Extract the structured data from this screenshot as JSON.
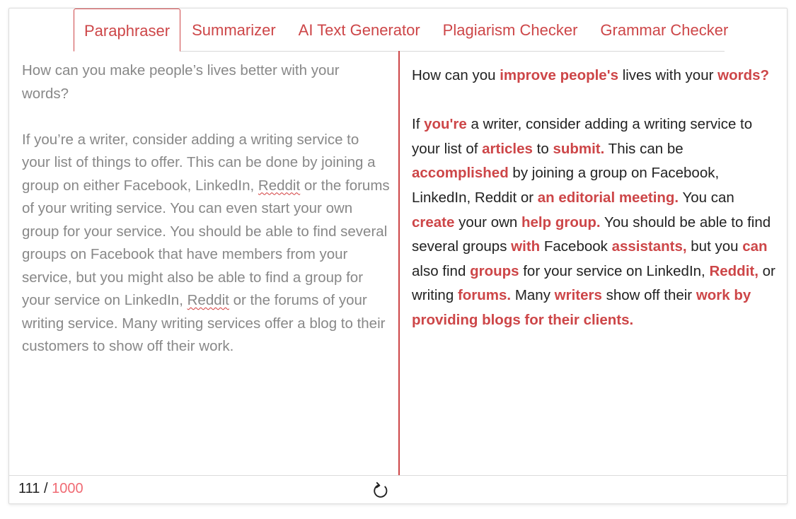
{
  "tabs": [
    {
      "label": "Paraphraser",
      "active": true
    },
    {
      "label": "Summarizer",
      "active": false
    },
    {
      "label": "AI Text Generator",
      "active": false
    },
    {
      "label": "Plagiarism Checker",
      "active": false
    },
    {
      "label": "Grammar Checker",
      "active": false
    }
  ],
  "input": {
    "p1": "How can you make people’s lives better with your words?",
    "p2_a": "If you’re a writer, consider adding a writing service to your list of things to offer. This can be done by joining a group on either Facebook, LinkedIn, ",
    "p2_flag1": "Reddit",
    "p2_b": " or the forums of your writing service. You can even start your own group for your service. You should be able to find several groups on Facebook that have members from your service, but you might also be able to find a group for your service on LinkedIn, ",
    "p2_flag2": "Reddit",
    "p2_c": " or the forums of your writing service. Many writing services offer a blog to their customers to show off their work."
  },
  "output": {
    "p1": [
      {
        "t": "How can you ",
        "h": false
      },
      {
        "t": "improve people's",
        "h": true
      },
      {
        "t": " lives with your ",
        "h": false
      },
      {
        "t": "words?",
        "h": true
      }
    ],
    "p2": [
      {
        "t": "If ",
        "h": false
      },
      {
        "t": "you're",
        "h": true
      },
      {
        "t": " a writer, consider adding a writing service to your list of ",
        "h": false
      },
      {
        "t": "articles",
        "h": true
      },
      {
        "t": " to ",
        "h": false
      },
      {
        "t": "submit.",
        "h": true
      },
      {
        "t": " This can be ",
        "h": false
      },
      {
        "t": "accomplished",
        "h": true
      },
      {
        "t": " by joining a group on Facebook, LinkedIn, Reddit or ",
        "h": false
      },
      {
        "t": "an editorial meeting.",
        "h": true
      },
      {
        "t": " You can ",
        "h": false
      },
      {
        "t": "create",
        "h": true
      },
      {
        "t": " your own ",
        "h": false
      },
      {
        "t": "help group.",
        "h": true
      },
      {
        "t": " You should be able to find several groups ",
        "h": false
      },
      {
        "t": "with",
        "h": true
      },
      {
        "t": " Facebook ",
        "h": false
      },
      {
        "t": "assistants,",
        "h": true
      },
      {
        "t": " but you ",
        "h": false
      },
      {
        "t": "can",
        "h": true
      },
      {
        "t": " also find ",
        "h": false
      },
      {
        "t": "groups",
        "h": true
      },
      {
        "t": " for your service on LinkedIn, ",
        "h": false
      },
      {
        "t": "Reddit,",
        "h": true
      },
      {
        "t": " or writing ",
        "h": false
      },
      {
        "t": "forums.",
        "h": true
      },
      {
        "t": " Many ",
        "h": false
      },
      {
        "t": "writers",
        "h": true
      },
      {
        "t": " show off their ",
        "h": false
      },
      {
        "t": "work by providing blogs for their clients.",
        "h": true
      }
    ]
  },
  "footer": {
    "count": "111",
    "separator": " / ",
    "limit": "1000",
    "refresh_icon": "refresh-icon"
  },
  "colors": {
    "accent": "#cd4648",
    "limit": "#f06b74",
    "input_text": "#888888",
    "output_text": "#222222"
  }
}
